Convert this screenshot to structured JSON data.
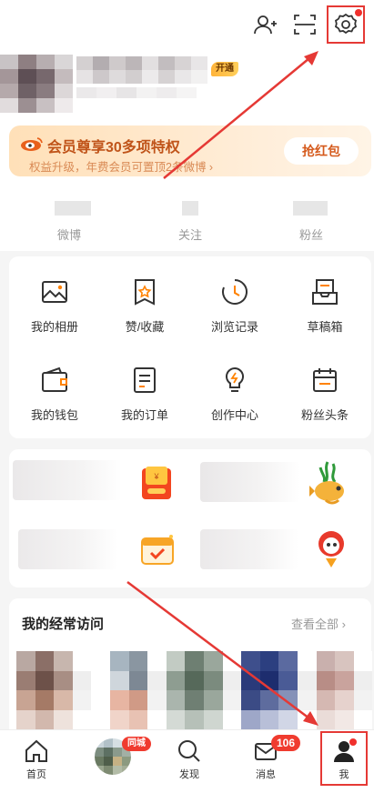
{
  "header": {
    "icons": [
      "add-friend-icon",
      "scan-icon",
      "settings-icon"
    ]
  },
  "profile": {
    "vip_tag": "开通"
  },
  "banner": {
    "title": "会员尊享30多项特权",
    "subtitle": "权益升级，年费会员可置顶2条微博 ›",
    "button": "抢红包"
  },
  "stats": [
    {
      "label": "微博"
    },
    {
      "label": "关注"
    },
    {
      "label": "粉丝"
    }
  ],
  "grid": [
    {
      "label": "我的相册",
      "icon": "album-icon"
    },
    {
      "label": "赞/收藏",
      "icon": "favorite-icon"
    },
    {
      "label": "浏览记录",
      "icon": "history-icon"
    },
    {
      "label": "草稿箱",
      "icon": "drafts-icon"
    },
    {
      "label": "我的钱包",
      "icon": "wallet-icon"
    },
    {
      "label": "我的订单",
      "icon": "orders-icon"
    },
    {
      "label": "创作中心",
      "icon": "creator-icon"
    },
    {
      "label": "粉丝头条",
      "icon": "fans-headline-icon"
    }
  ],
  "visits": {
    "title": "我的经常访问",
    "view_all": "查看全部"
  },
  "tabbar": {
    "items": [
      {
        "label": "首页",
        "icon": "home-icon"
      },
      {
        "label": "",
        "icon": "mall-avatar",
        "badge": "同城"
      },
      {
        "label": "发现",
        "icon": "search-icon"
      },
      {
        "label": "消息",
        "icon": "mail-icon",
        "badge": "106"
      },
      {
        "label": "我",
        "icon": "profile-icon"
      }
    ]
  },
  "colors": {
    "accent": "#ff8200",
    "badge": "#f03b2f",
    "annotation": "#e53935"
  }
}
